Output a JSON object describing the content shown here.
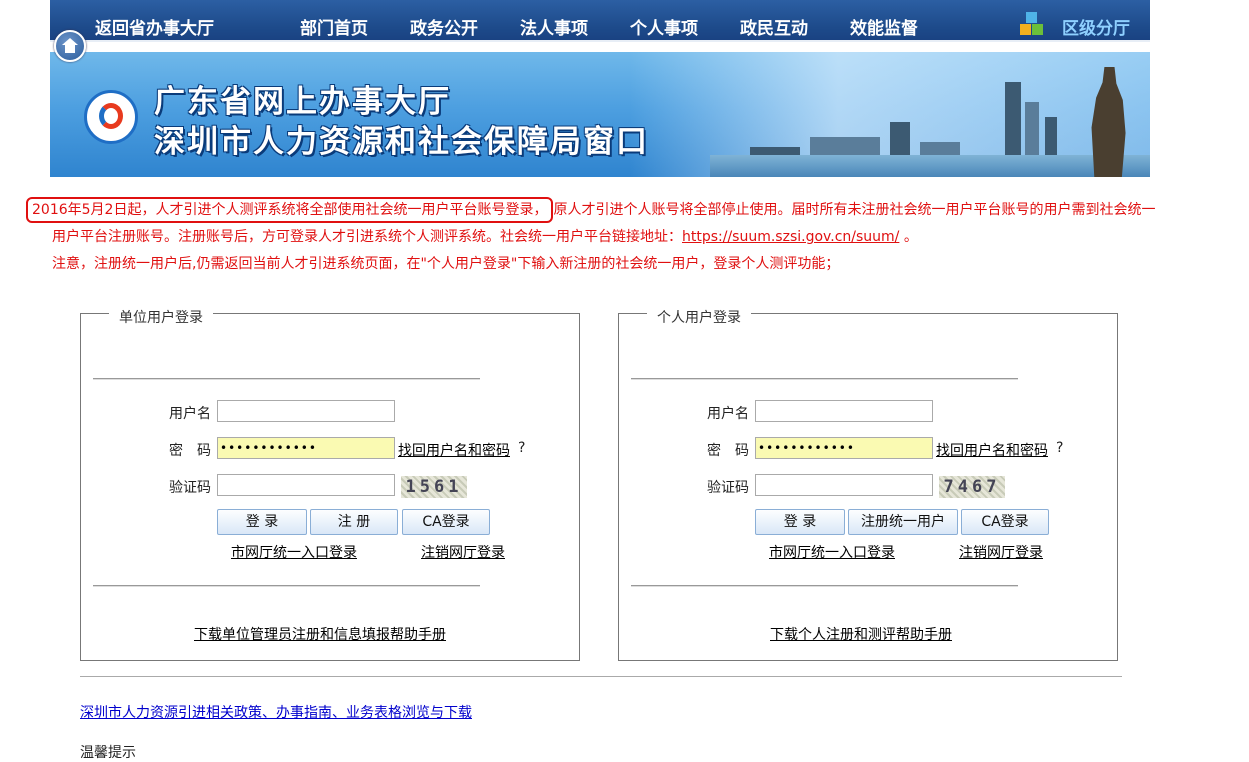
{
  "nav": {
    "back": "返回省办事大厅",
    "items": [
      "部门首页",
      "政务公开",
      "法人事项",
      "个人事项",
      "政民互动",
      "效能监督"
    ],
    "district": "区级分厅"
  },
  "banner": {
    "title1": "广东省网上办事大厅",
    "title2": "深圳市人力资源和社会保障局窗口"
  },
  "notice": {
    "highlight": "2016年5月2日起，人才引进个人测评系统将全部使用社会统一用户平台账号登录，",
    "rest1": "原人才引进个人账号将全部停止使用。届时所有未注册社会统一用户平台账号的用户需到社会统一用户平台注册账号。注册账号后，方可登录人才引进系统个人测评系统。社会统一用户平台链接地址：",
    "link": "https://suum.szsi.gov.cn/suum/",
    "rest2": " 。",
    "line3": "注意，注册统一用户后,仍需返回当前人才引进系统页面，在\"个人用户登录\"下输入新注册的社会统一用户，登录个人测评功能；"
  },
  "unit": {
    "legend": "单位用户登录",
    "username_label": "用户名",
    "password_label": "密　码",
    "password_value": "••••••••••••",
    "forgot": "找回用户名和密码",
    "forgot_q": "?",
    "captcha_label": "验证码",
    "captcha": "1561",
    "btn_login": "登 录",
    "btn_register": "注 册",
    "btn_ca": "CA登录",
    "link_city": "市网厅统一入口登录",
    "link_logout": "注销网厅登录",
    "manual": "下载单位管理员注册和信息填报帮助手册"
  },
  "personal": {
    "legend": "个人用户登录",
    "username_label": "用户名",
    "password_label": "密　码",
    "password_value": "••••••••••••",
    "forgot": "找回用户名和密码",
    "forgot_q": "?",
    "captcha_label": "验证码",
    "captcha": "7467",
    "btn_login": "登 录",
    "btn_register": "注册统一用户",
    "btn_ca": "CA登录",
    "link_city": "市网厅统一入口登录",
    "link_logout": "注销网厅登录",
    "manual": "下载个人注册和测评帮助手册"
  },
  "policy_link": "深圳市人力资源引进相关政策、办事指南、业务表格浏览与下载",
  "tips": "温馨提示",
  "colors": {
    "nav_bg": "#1d4a8a",
    "notice": "#e01010",
    "link": "#0000cc"
  }
}
